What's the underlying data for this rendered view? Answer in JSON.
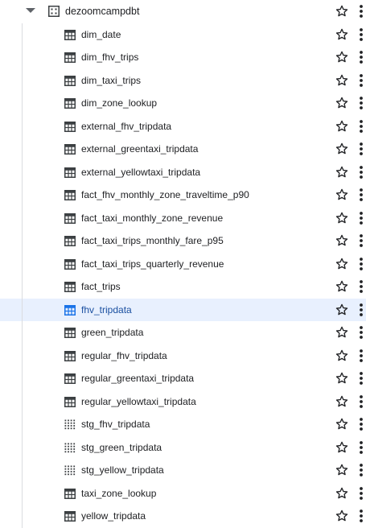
{
  "dataset": {
    "name": "dezoomcampdbt",
    "icon": "dataset-icon"
  },
  "items": [
    {
      "label": "dim_date",
      "type": "table",
      "selected": false
    },
    {
      "label": "dim_fhv_trips",
      "type": "table",
      "selected": false
    },
    {
      "label": "dim_taxi_trips",
      "type": "table",
      "selected": false
    },
    {
      "label": "dim_zone_lookup",
      "type": "table",
      "selected": false
    },
    {
      "label": "external_fhv_tripdata",
      "type": "table",
      "selected": false
    },
    {
      "label": "external_greentaxi_tripdata",
      "type": "table",
      "selected": false
    },
    {
      "label": "external_yellowtaxi_tripdata",
      "type": "table",
      "selected": false
    },
    {
      "label": "fact_fhv_monthly_zone_traveltime_p90",
      "type": "table",
      "selected": false
    },
    {
      "label": "fact_taxi_monthly_zone_revenue",
      "type": "table",
      "selected": false
    },
    {
      "label": "fact_taxi_trips_monthly_fare_p95",
      "type": "table",
      "selected": false
    },
    {
      "label": "fact_taxi_trips_quarterly_revenue",
      "type": "table",
      "selected": false
    },
    {
      "label": "fact_trips",
      "type": "table",
      "selected": false
    },
    {
      "label": "fhv_tripdata",
      "type": "table",
      "selected": true
    },
    {
      "label": "green_tripdata",
      "type": "table",
      "selected": false
    },
    {
      "label": "regular_fhv_tripdata",
      "type": "table",
      "selected": false
    },
    {
      "label": "regular_greentaxi_tripdata",
      "type": "table",
      "selected": false
    },
    {
      "label": "regular_yellowtaxi_tripdata",
      "type": "table",
      "selected": false
    },
    {
      "label": "stg_fhv_tripdata",
      "type": "view",
      "selected": false
    },
    {
      "label": "stg_green_tripdata",
      "type": "view",
      "selected": false
    },
    {
      "label": "stg_yellow_tripdata",
      "type": "view",
      "selected": false
    },
    {
      "label": "taxi_zone_lookup",
      "type": "table",
      "selected": false
    },
    {
      "label": "yellow_tripdata",
      "type": "table",
      "selected": false
    }
  ],
  "icons": {
    "table": "table-icon",
    "view": "view-icon",
    "star": "star-outline-icon",
    "more": "more-vert-icon",
    "expand": "caret-down-icon"
  },
  "colors": {
    "selected_bg": "#e8f0fe",
    "selected_text": "#1a4fa0",
    "icon": "#3c4043",
    "selected_icon": "#1a73e8"
  }
}
